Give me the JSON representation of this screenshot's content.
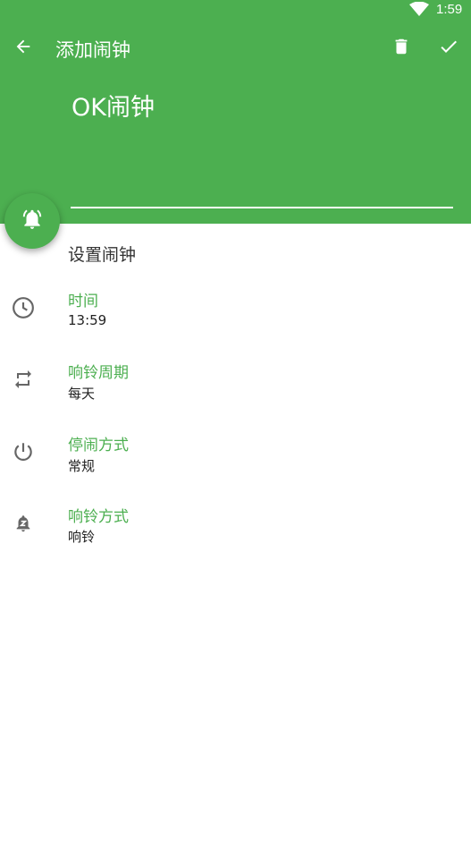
{
  "status_bar": {
    "time": "1:59",
    "wifi_icon": "wifi-icon"
  },
  "toolbar": {
    "title": "添加闹钟",
    "back_icon": "arrow-back-icon",
    "delete_icon": "trash-icon",
    "confirm_icon": "check-icon"
  },
  "alarm_name": "OK闹钟",
  "fab_icon": "alarm-bell-icon",
  "section_title": "设置闹钟",
  "settings": [
    {
      "icon": "clock-icon",
      "title": "时间",
      "value": "13:59"
    },
    {
      "icon": "repeat-icon",
      "title": "响铃周期",
      "value": "每天"
    },
    {
      "icon": "power-icon",
      "title": "停闹方式",
      "value": "常规"
    },
    {
      "icon": "snooze-bell-icon",
      "title": "响铃方式",
      "value": "响铃"
    }
  ],
  "colors": {
    "primary": "#4caf50",
    "icon_gray": "#666666",
    "text_dark": "#222222"
  }
}
